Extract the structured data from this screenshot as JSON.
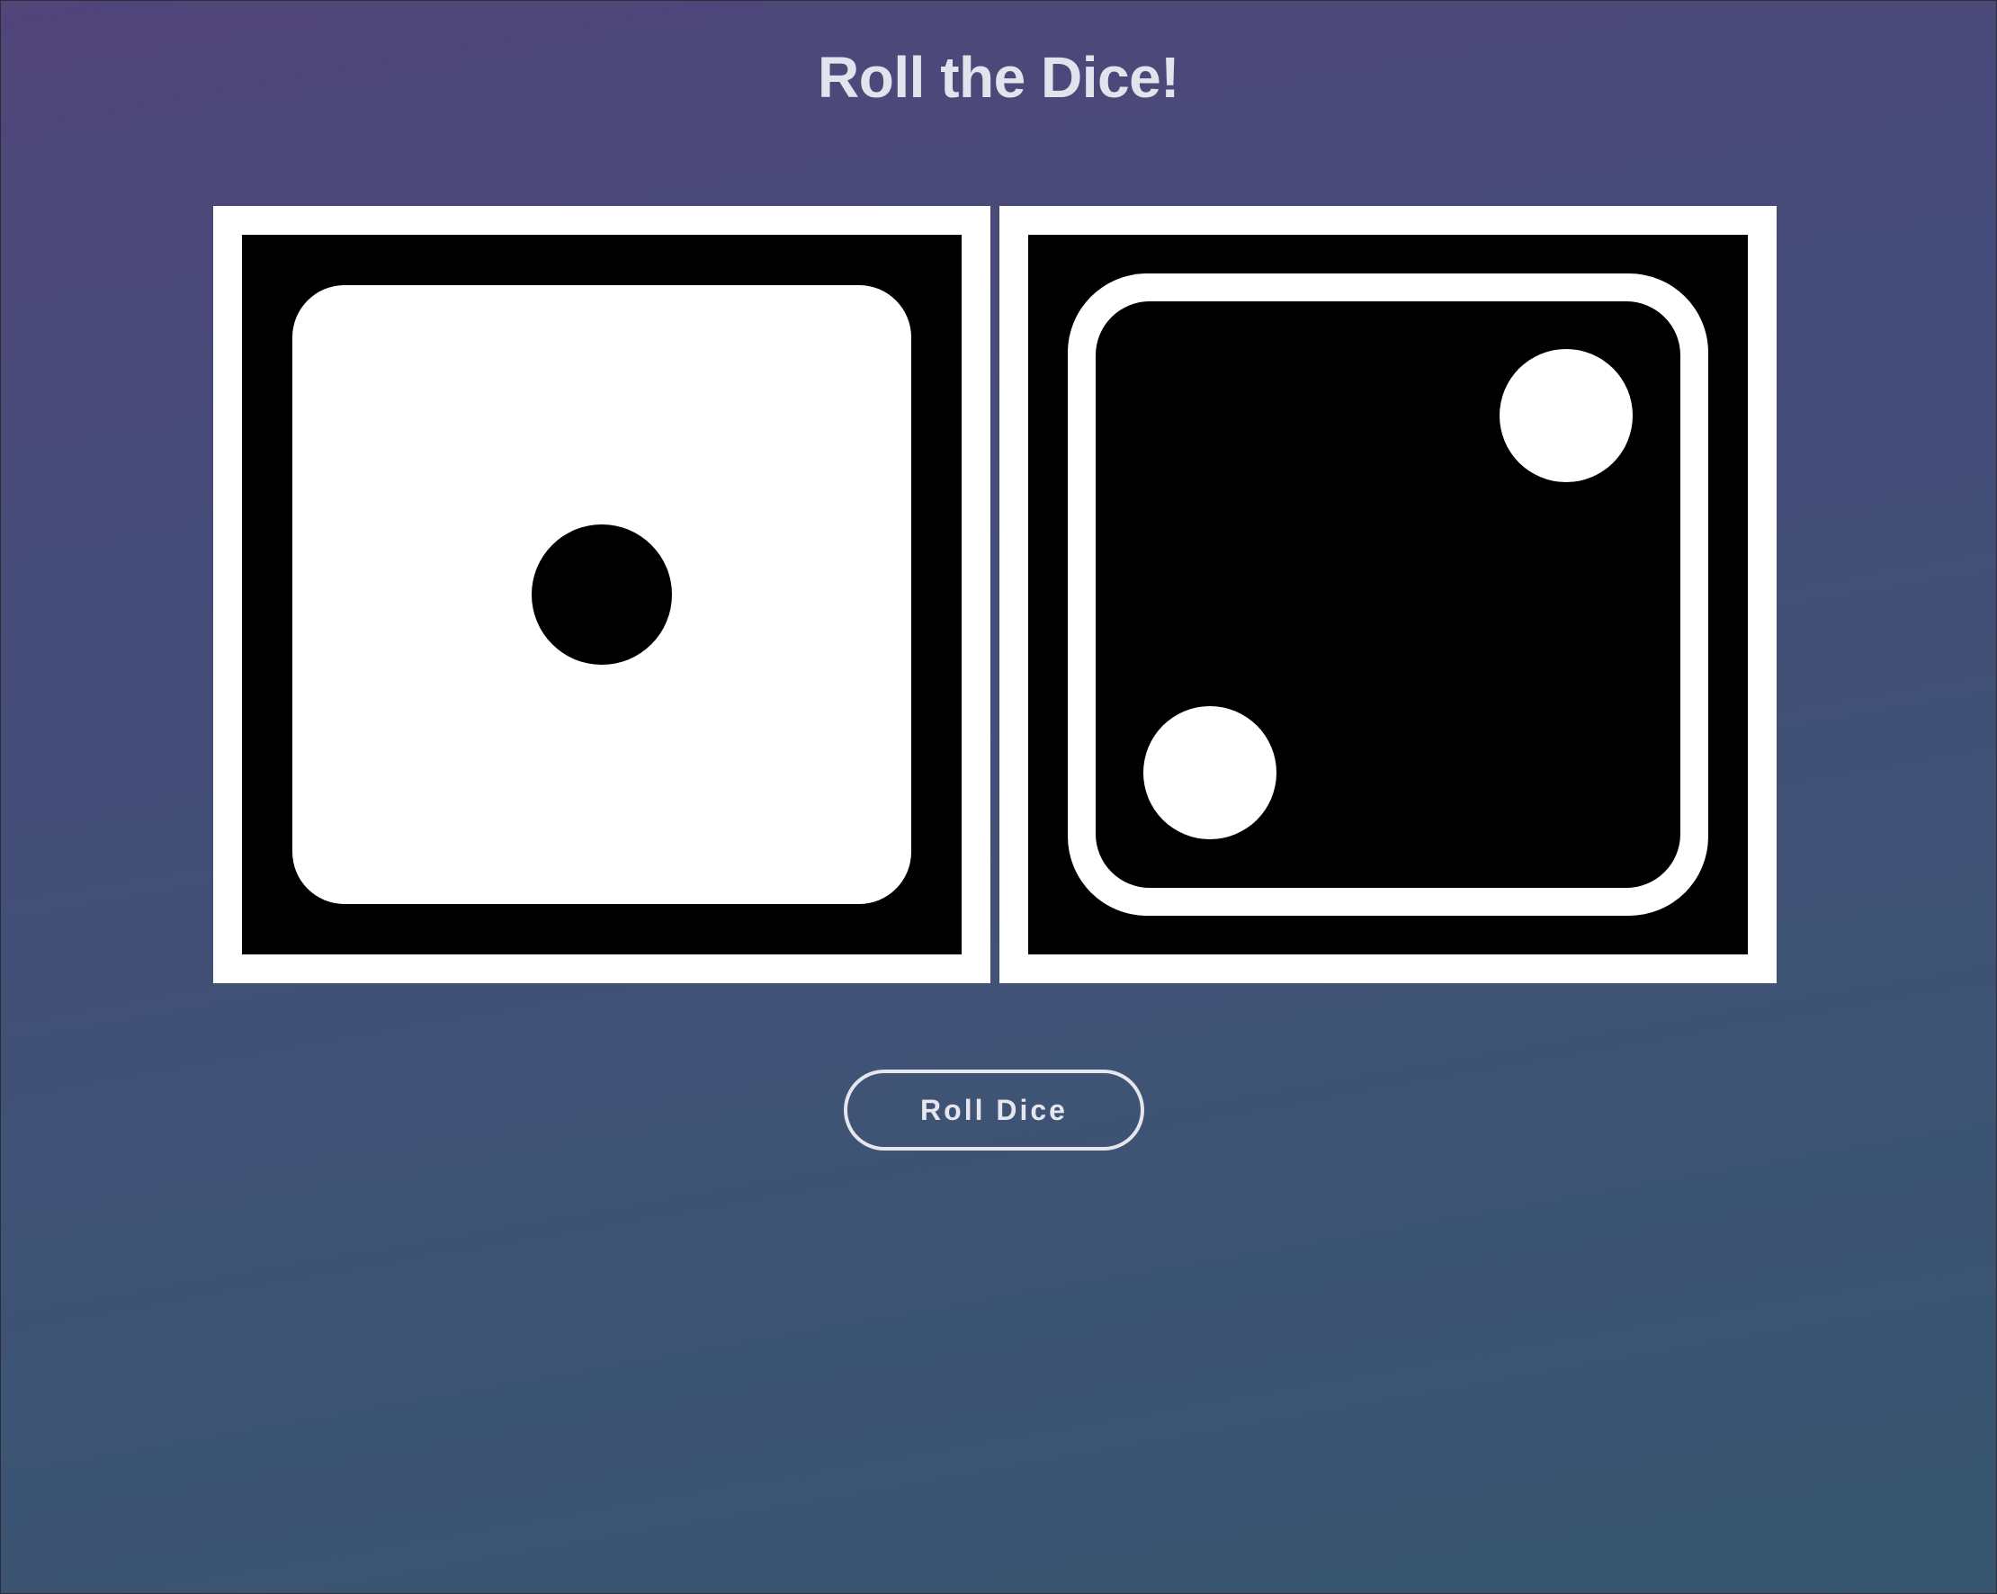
{
  "page": {
    "title": "Roll the Dice!"
  },
  "dice": [
    {
      "name": "die-one",
      "value": 1,
      "face_style": "white-face-black-pips"
    },
    {
      "name": "die-two",
      "value": 2,
      "face_style": "black-face-white-pips"
    }
  ],
  "controls": {
    "roll_button_label": "Roll Dice"
  },
  "colors": {
    "background_top": "#51457a",
    "background_bottom": "#37566f",
    "text": "#e3e3ee",
    "die_frame": "#ffffff",
    "die_black": "#000000"
  }
}
